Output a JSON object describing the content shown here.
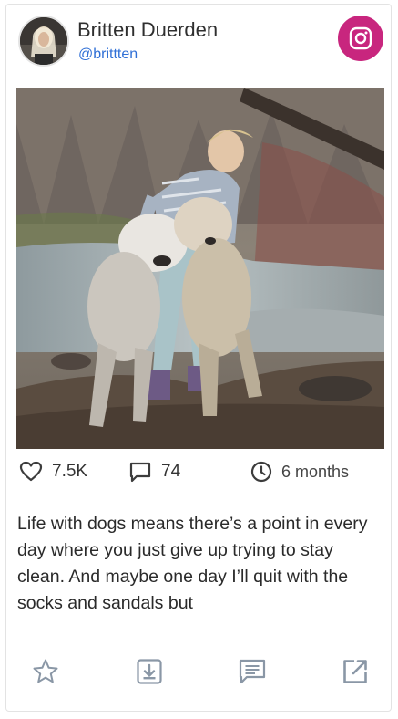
{
  "profile": {
    "name": "Britten Duerden",
    "handle": "@brittten"
  },
  "network": {
    "icon": "instagram-icon",
    "color": "#c8267e"
  },
  "photo": {
    "alt": "Woman in a wetsuit holding two wet doodle dogs by a creek"
  },
  "stats": {
    "likes": "7.5K",
    "comments": "74",
    "age": "6 months"
  },
  "caption": "Life with dogs means there’s a point in every day where you just give up trying to stay clean. And maybe one day I’ll quit with the socks and sandals but",
  "actions": [
    "star-icon",
    "download-icon",
    "comment-icon",
    "external-link-icon"
  ],
  "colors": {
    "accent": "#2f6fd6",
    "icon": "#8a97a6"
  }
}
